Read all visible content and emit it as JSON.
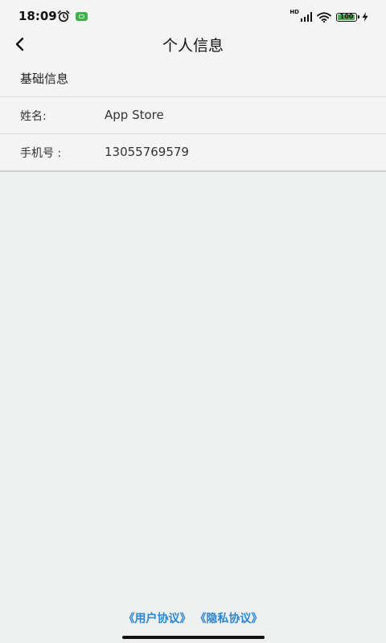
{
  "status_bar": {
    "time": "18:09",
    "network_label": "HD",
    "battery_level": "100",
    "battery_color": "#4caf50",
    "icons": [
      "alarm-icon",
      "app-notification-icon",
      "signal-icon",
      "wifi-icon",
      "battery-icon",
      "charging-icon"
    ]
  },
  "nav": {
    "title": "个人信息",
    "back_icon": "chevron-left-icon"
  },
  "section": {
    "title": "基础信息"
  },
  "info": {
    "rows": [
      {
        "label": "姓名:",
        "value": "App Store"
      },
      {
        "label": "手机号 :",
        "value": "13055769579"
      }
    ]
  },
  "footer": {
    "user_agreement": "《用户协议》",
    "privacy_policy": "《隐私协议》",
    "link_color": "#2a86d6"
  }
}
